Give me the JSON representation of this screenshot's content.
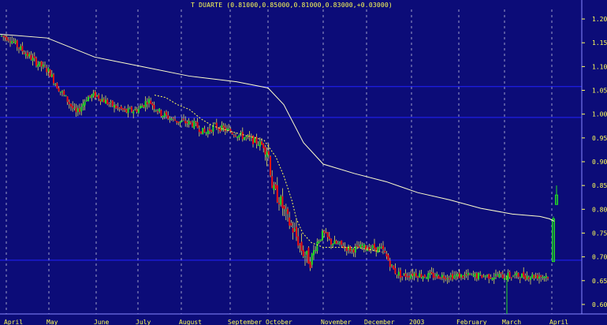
{
  "chart_data": {
    "type": "candlestick",
    "title": "T DUARTE (0.81000,0.85000,0.81000,0.83000,+0.03000)",
    "ylim": [
      0.58,
      1.22
    ],
    "y_ticks": [
      "1.20",
      "1.15",
      "1.10",
      "1.05",
      "1.00",
      "0.95",
      "0.90",
      "0.85",
      "0.80",
      "0.75",
      "0.70",
      "0.65",
      "0.60"
    ],
    "y_tick_values": [
      1.2,
      1.15,
      1.1,
      1.05,
      1.0,
      0.95,
      0.9,
      0.85,
      0.8,
      0.75,
      0.7,
      0.65,
      0.6
    ],
    "x_labels": [
      "April",
      "May",
      "June",
      "July",
      "August",
      "September",
      "October",
      "November",
      "December",
      "2003",
      "February",
      "March",
      "April"
    ],
    "horizontal_lines": [
      1.058,
      0.993,
      0.693
    ],
    "price_anchors": [
      [
        0,
        1.165
      ],
      [
        12,
        1.16
      ],
      [
        24,
        1.14
      ],
      [
        45,
        1.11
      ],
      [
        62,
        1.09
      ],
      [
        72,
        1.06
      ],
      [
        85,
        1.03
      ],
      [
        97,
        1.0
      ],
      [
        110,
        1.035
      ],
      [
        122,
        1.04
      ],
      [
        140,
        1.02
      ],
      [
        160,
        1.005
      ],
      [
        175,
        1.01
      ],
      [
        188,
        1.03
      ],
      [
        205,
        1.0
      ],
      [
        225,
        0.985
      ],
      [
        245,
        0.98
      ],
      [
        260,
        0.96
      ],
      [
        272,
        0.975
      ],
      [
        290,
        0.965
      ],
      [
        305,
        0.955
      ],
      [
        320,
        0.945
      ],
      [
        333,
        0.935
      ],
      [
        340,
        0.925
      ],
      [
        346,
        0.84
      ],
      [
        355,
        0.82
      ],
      [
        364,
        0.78
      ],
      [
        374,
        0.75
      ],
      [
        384,
        0.71
      ],
      [
        394,
        0.69
      ],
      [
        402,
        0.73
      ],
      [
        410,
        0.75
      ],
      [
        420,
        0.73
      ],
      [
        432,
        0.725
      ],
      [
        445,
        0.715
      ],
      [
        458,
        0.72
      ],
      [
        470,
        0.72
      ],
      [
        485,
        0.715
      ],
      [
        492,
        0.695
      ],
      [
        500,
        0.67
      ],
      [
        510,
        0.66
      ],
      [
        525,
        0.665
      ],
      [
        540,
        0.66
      ],
      [
        560,
        0.66
      ],
      [
        580,
        0.66
      ],
      [
        600,
        0.66
      ],
      [
        620,
        0.66
      ],
      [
        640,
        0.66
      ],
      [
        660,
        0.66
      ],
      [
        685,
        0.66
      ],
      [
        697,
        0.66
      ]
    ],
    "ma_long": [
      [
        0,
        1.168
      ],
      [
        60,
        1.16
      ],
      [
        120,
        1.12
      ],
      [
        180,
        1.1
      ],
      [
        240,
        1.08
      ],
      [
        300,
        1.068
      ],
      [
        340,
        1.055
      ],
      [
        360,
        1.02
      ],
      [
        385,
        0.94
      ],
      [
        410,
        0.895
      ],
      [
        450,
        0.875
      ],
      [
        490,
        0.858
      ],
      [
        530,
        0.835
      ],
      [
        570,
        0.82
      ],
      [
        610,
        0.802
      ],
      [
        650,
        0.79
      ],
      [
        685,
        0.785
      ],
      [
        697,
        0.78
      ],
      [
        703,
        0.775
      ]
    ],
    "ma_short": [
      [
        196,
        1.04
      ],
      [
        210,
        1.035
      ],
      [
        225,
        1.02
      ],
      [
        240,
        1.01
      ],
      [
        255,
        0.99
      ],
      [
        270,
        0.975
      ],
      [
        290,
        0.965
      ],
      [
        305,
        0.958
      ],
      [
        320,
        0.952
      ],
      [
        335,
        0.945
      ],
      [
        350,
        0.91
      ],
      [
        360,
        0.87
      ],
      [
        370,
        0.82
      ],
      [
        376,
        0.78
      ],
      [
        384,
        0.75
      ],
      [
        395,
        0.73
      ],
      [
        410,
        0.72
      ],
      [
        430,
        0.72
      ],
      [
        450,
        0.72
      ],
      [
        470,
        0.715
      ],
      [
        485,
        0.71
      ]
    ],
    "spike_dip": {
      "x": 643,
      "low": 0.58
    },
    "last_bars": [
      {
        "x": 702,
        "open": 0.69,
        "close": 0.78,
        "high": 0.785,
        "low": 0.69
      },
      {
        "x": 706,
        "open": 0.81,
        "close": 0.83,
        "high": 0.85,
        "low": 0.81
      }
    ],
    "colors": {
      "background": "#0c0c78",
      "up": "#22dd22",
      "down": "#ee1111",
      "wick": "#ffff55",
      "ma_long": "#ffffcc",
      "ma_short": "#ffff55",
      "grid": "#2222ff",
      "axis_text": "#ffff55"
    }
  }
}
